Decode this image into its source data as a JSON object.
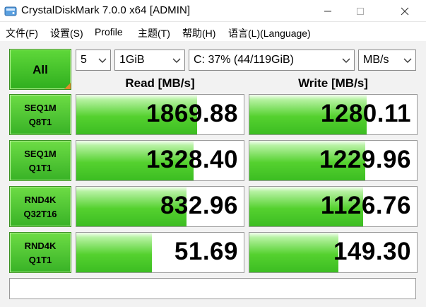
{
  "window": {
    "title": "CrystalDiskMark 7.0.0 x64 [ADMIN]"
  },
  "menu": {
    "items": [
      "文件(F)",
      "设置(S)",
      "Profile",
      "主题(T)",
      "帮助(H)",
      "语言(L)(Language)"
    ]
  },
  "controls": {
    "all_label": "All",
    "count_value": "5",
    "size_value": "1GiB",
    "drive_value": "C: 37% (44/119GiB)",
    "unit_value": "MB/s"
  },
  "headers": {
    "read": "Read [MB/s]",
    "write": "Write [MB/s]"
  },
  "tests": [
    {
      "line1": "SEQ1M",
      "line2": "Q8T1",
      "read": "1869.88",
      "write": "1280.11",
      "read_fill": 0.72,
      "write_fill": 0.7
    },
    {
      "line1": "SEQ1M",
      "line2": "Q1T1",
      "read": "1328.40",
      "write": "1229.96",
      "read_fill": 0.7,
      "write_fill": 0.69
    },
    {
      "line1": "RND4K",
      "line2": "Q32T16",
      "read": "832.96",
      "write": "1126.76",
      "read_fill": 0.66,
      "write_fill": 0.68
    },
    {
      "line1": "RND4K",
      "line2": "Q1T1",
      "read": "51.69",
      "write": "149.30",
      "read_fill": 0.45,
      "write_fill": 0.53
    }
  ],
  "status_text": "",
  "colors": {
    "accent_green": "#3cbd22",
    "corner_orange": "#e08a2c"
  }
}
